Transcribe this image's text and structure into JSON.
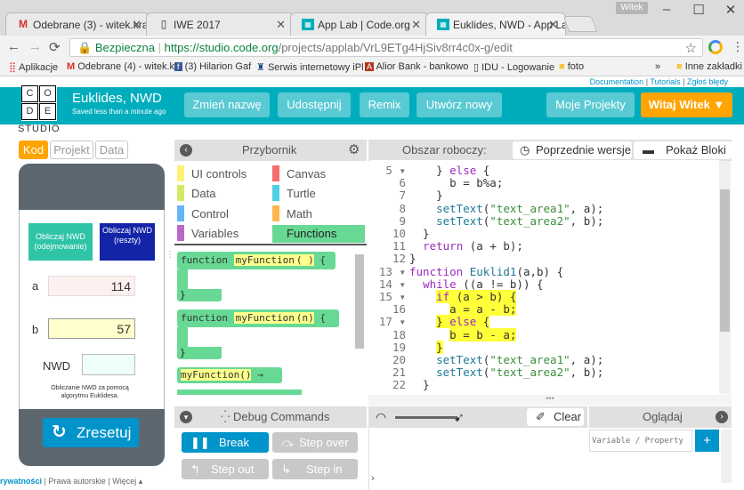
{
  "browser": {
    "tabs": [
      {
        "title": "Odebrane (3) - witek.kra"
      },
      {
        "title": "IWE 2017"
      },
      {
        "title": "App Lab | Code.org"
      },
      {
        "title": "Euklides, NWD - App Lab"
      }
    ],
    "profile": "Witek",
    "secure_label": "Bezpieczna",
    "url_host": "https://studio.code.org",
    "url_path": "/projects/applab/VrL9ETg4HjSiv8rr4c0x-g/edit",
    "bookmarks": [
      "Aplikacje",
      "Odebrane (4) - witek.k",
      "(3) Hilarion Gaf",
      "Serwis internetowy iPl",
      "Alior Bank - bankowo",
      "IDU - Logowanie",
      "foto",
      "»",
      "Inne zakładki"
    ]
  },
  "header": {
    "logo_letters": [
      "C",
      "O",
      "D",
      "E"
    ],
    "logo_studio": "STUDIO",
    "doc_link": "Documentation",
    "sep": "|",
    "tutorials_link": "Tutorials",
    "report_link": "Zgłoś błędy",
    "project_title": "Euklides, NWD",
    "saved_status": "Saved less than a minute ago",
    "rename": "Zmień nazwę",
    "share": "Udostępnij",
    "remix": "Remix",
    "new": "Utwórz nowy",
    "my_projects": "Moje Projekty",
    "user_menu": "Witaj Witek ▼"
  },
  "left": {
    "tabs": {
      "code": "Kod",
      "project": "Projekt",
      "data": "Data"
    },
    "app": {
      "btn_sub": "Obliczaj NWD (odejmowanie)",
      "btn_mod": "Obliczaj NWD (reszty)",
      "label_a": "a",
      "value_a": "114",
      "label_b": "b",
      "value_b": "57",
      "label_nwd": "NWD",
      "value_nwd": "",
      "caption": "Obliczanie NWD za pomocą algorytmu Euklidesa."
    },
    "reset": "Zresetuj",
    "footer": {
      "privacy": "rywatności",
      "copyright": "Prawa autorskie",
      "more": "Więcej ▴"
    }
  },
  "toolbox": {
    "title": "Przybornik",
    "categories": [
      {
        "label": "UI controls",
        "color": "#fff176"
      },
      {
        "label": "Canvas",
        "color": "#f46c6c"
      },
      {
        "label": "Data",
        "color": "#d3e965"
      },
      {
        "label": "Turtle",
        "color": "#4dd0e1"
      },
      {
        "label": "Control",
        "color": "#64b5f6"
      },
      {
        "label": "Math",
        "color": "#ffb74d"
      },
      {
        "label": "Variables",
        "color": "#ba68c8"
      },
      {
        "label": "Functions",
        "color": "#68d995"
      }
    ],
    "blocks": [
      {
        "kw": "function",
        "name": "myFunction",
        "args": "( )",
        "brace": "{"
      },
      {
        "kw": "function",
        "name": "myFunction",
        "args": "(n)",
        "brace": "{"
      },
      {
        "call": "myFunction()",
        "arrow": "→"
      }
    ]
  },
  "workspace": {
    "title": "Obszar roboczy:",
    "versions": "Poprzednie wersje",
    "show_blocks": "Pokaż Bloki",
    "lines": [
      {
        "n": "5",
        "fold": "▾",
        "code": "    } else {"
      },
      {
        "n": "6",
        "fold": "",
        "code": "      b = b%a;"
      },
      {
        "n": "7",
        "fold": "",
        "code": "    }"
      },
      {
        "n": "8",
        "fold": "",
        "code": "    setText(\"text_area1\", a);"
      },
      {
        "n": "9",
        "fold": "",
        "code": "    setText(\"text_area2\", b);"
      },
      {
        "n": "10",
        "fold": "",
        "code": "  }"
      },
      {
        "n": "11",
        "fold": "",
        "code": "  return (a + b);"
      },
      {
        "n": "12",
        "fold": "",
        "code": "}"
      },
      {
        "n": "13",
        "fold": "▾",
        "code": "function Euklid1(a,b) {"
      },
      {
        "n": "14",
        "fold": "▾",
        "code": "  while ((a != b)) {"
      },
      {
        "n": "15",
        "fold": "▾",
        "code": "    if (a > b) {"
      },
      {
        "n": "16",
        "fold": "",
        "code": "      a = a - b;"
      },
      {
        "n": "17",
        "fold": "▾",
        "code": "    } else {"
      },
      {
        "n": "18",
        "fold": "",
        "code": "      b = b - a;"
      },
      {
        "n": "19",
        "fold": "",
        "code": "    }"
      },
      {
        "n": "20",
        "fold": "",
        "code": "    setText(\"text_area1\", a);"
      },
      {
        "n": "21",
        "fold": "",
        "code": "    setText(\"text_area2\", b);"
      },
      {
        "n": "22",
        "fold": "",
        "code": "  }"
      }
    ],
    "highlight_lines": [
      "15",
      "16",
      "17",
      "18",
      "19"
    ]
  },
  "debug": {
    "title": "Debug Commands",
    "break": "Break",
    "step_over": "Step over",
    "step_out": "Step out",
    "step_in": "Step in",
    "clear": "Clear",
    "watch_title": "Oglądaj",
    "watch_placeholder": "Variable / Property",
    "add": "+",
    "prompt": "›"
  }
}
